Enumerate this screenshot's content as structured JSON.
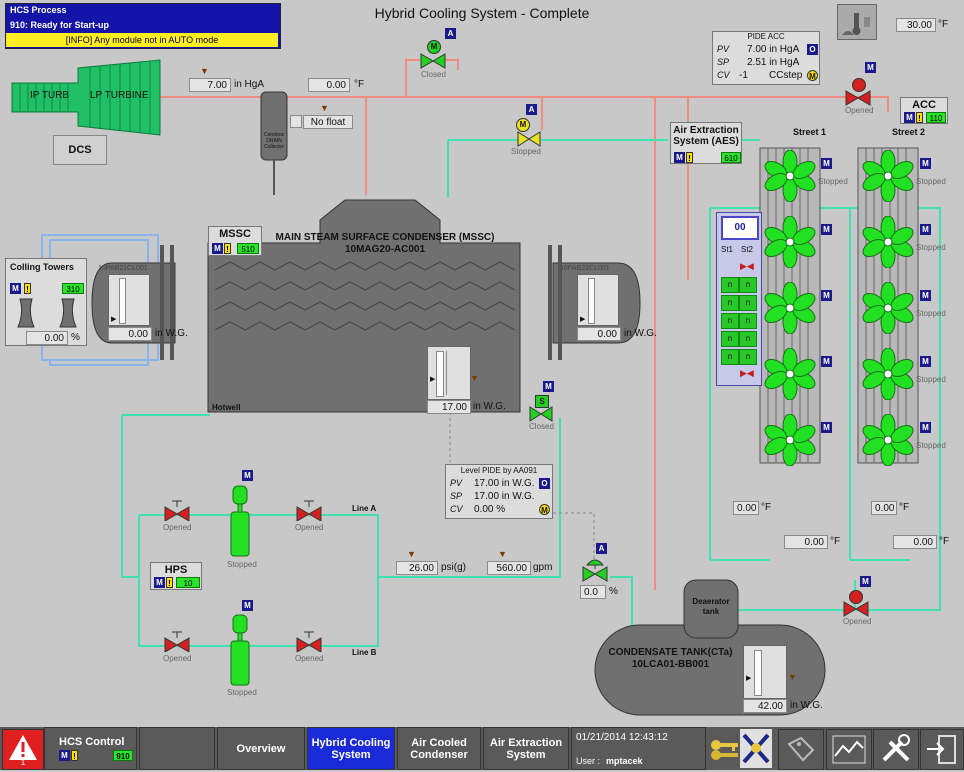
{
  "title": "Hybrid Cooling System - Complete",
  "process_box": {
    "header": "HCS Process",
    "status": "910: Ready for Start-up",
    "info": "[INFO] Any module not in AUTO mode"
  },
  "ambient": {
    "temp": "30.00",
    "unit": "°F"
  },
  "turbine": {
    "ip": "IP TURB",
    "lp": "LP TURBINE",
    "dcs": "DCS"
  },
  "steam": {
    "pressure": "7.00",
    "pressure_unit": "in HgA",
    "temp": "0.00",
    "temp_unit": "°F"
  },
  "drain": {
    "label": "Condenz DRAIN Collector",
    "float": "No float"
  },
  "top_valve": {
    "tag": "A",
    "motor": "M",
    "state": "Closed"
  },
  "pide_acc": {
    "title": "PIDE ACC",
    "rows": [
      {
        "k": "PV",
        "v": "7.00 in HgA",
        "b": "O"
      },
      {
        "k": "SP",
        "v": "2.51 in HgA",
        "b": ""
      },
      {
        "k": "CV",
        "v": "-1",
        "u": "CCstep",
        "b": "M"
      }
    ]
  },
  "acc_valve": {
    "tag": "M",
    "state": "Opened"
  },
  "acc_box": {
    "title": "ACC",
    "count": "110"
  },
  "streets": {
    "s1": "Street 1",
    "s2": "Street 2"
  },
  "aes": {
    "title": "Air Extraction System (AES)",
    "count": "610"
  },
  "aes_valve": {
    "tag": "A",
    "motor": "M",
    "state": "Stopped"
  },
  "fan_state": "Stopped",
  "fan_tag": "M",
  "mssc": {
    "label": "MSSC",
    "count": "510",
    "title": "MAIN STEAM SURFACE CONDENSER (MSSC)",
    "id": "10MAG20-AC001",
    "hotwell": "Hotwell",
    "level": "17.00",
    "level_unit": "in W.G."
  },
  "left_gauge": {
    "id": "10PAB21CL001",
    "value": "0.00",
    "unit": "in W.G."
  },
  "right_gauge": {
    "id": "10PAB22CL001",
    "value": "0.00",
    "unit": "in W.G."
  },
  "towers": {
    "title": "Colling Towers",
    "count": "310",
    "value": "0.00",
    "unit": "%"
  },
  "st_panel": {
    "display": "00",
    "st1": "St1",
    "st2": "St2",
    "cells": [
      "n",
      "n",
      "n",
      "n",
      "n",
      "n",
      "n",
      "n",
      "n",
      "n"
    ]
  },
  "street_temps": {
    "t1": "0.00",
    "t2": "0.00",
    "t3": "0.00",
    "t4": "0.00",
    "unit": "°F"
  },
  "level_pide": {
    "title": "Level PIDE by AA091",
    "rows": [
      {
        "k": "PV",
        "v": "17.00 in W.G.",
        "b": "O"
      },
      {
        "k": "SP",
        "v": "17.00 in W.G.",
        "b": ""
      },
      {
        "k": "CV",
        "v": "0.00 %",
        "b": "M"
      }
    ]
  },
  "s_valve": {
    "tag": "M",
    "motor": "S",
    "state": "Closed"
  },
  "hps": {
    "title": "HPS",
    "count": "10"
  },
  "pumps": {
    "tag": "M",
    "state": "Stopped",
    "line_a": "Line A",
    "line_b": "Line B",
    "valve_state": "Opened"
  },
  "header_pressure": {
    "value": "26.00",
    "unit": "psi(g)"
  },
  "flow": {
    "value": "560.00",
    "unit": "gpm"
  },
  "ctrl_valve": {
    "tag": "A",
    "value": "0.0",
    "unit": "%"
  },
  "deaerator": {
    "label": "Deaerator tank"
  },
  "ct_valve": {
    "tag": "M",
    "state": "Opened"
  },
  "condensate": {
    "title": "CONDENSATE TANK(CTa)",
    "id": "10LCA01-BB001",
    "value": "42.00",
    "unit": "in W.G."
  },
  "nav": {
    "alarm_count": "1",
    "hcs_control": "HCS Control",
    "hcs_count": "910",
    "overview": "Overview",
    "hybrid": "Hybrid Cooling System",
    "acc": "Air Cooled Condenser",
    "aes": "Air Extraction System",
    "datetime": "01/21/2014 12:43:12",
    "user_label": "User :",
    "user": "mptacek"
  },
  "colors": {
    "steam": "#f08b80",
    "water": "#40e0b0",
    "green": "#22d022",
    "bg": "#c8c8c8"
  }
}
